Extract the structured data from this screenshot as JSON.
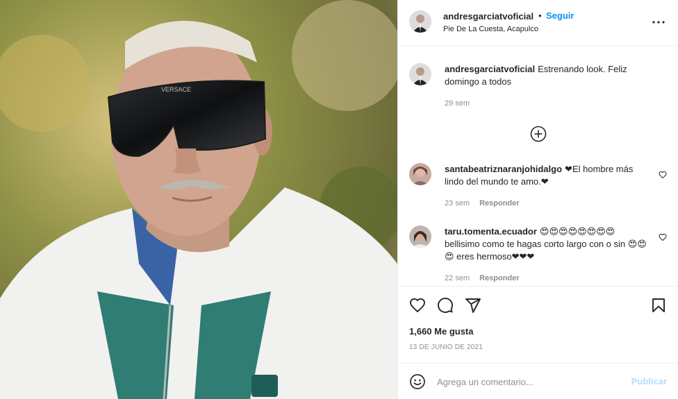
{
  "post": {
    "image_alt": "Man wearing Versace shield sunglasses and white track jacket",
    "sunglasses_brand_text": "VERSACE",
    "author": "andresgarciatvoficial",
    "follow_label": "Seguir",
    "separator": "•",
    "location": "Pie De La Cuesta, Acapulco"
  },
  "caption": {
    "username": "andresgarciatvoficial",
    "text": "Estrenando look. Feliz domingo a todos",
    "time": "29 sem"
  },
  "comments": [
    {
      "username": "santabeatriznaranjohidalgo",
      "text": "❤El hombre más lindo del mundo te amo.❤",
      "time": "23 sem",
      "reply_label": "Responder"
    },
    {
      "username": "taru.tomenta.ecuador",
      "text": "😍😍😍😍😍😍😍😍 bellisimo como te hagas corto largo con o sin 😍😍😍 eres hermoso❤❤❤",
      "time": "22 sem",
      "reply_label": "Responder"
    }
  ],
  "actions": {
    "likes": "1,660 Me gusta",
    "date": "13 DE JUNIO DE 2021"
  },
  "add_comment": {
    "placeholder": "Agrega un comentario...",
    "publish_label": "Publicar"
  },
  "colors": {
    "link_blue": "#0095f6",
    "publish_disabled": "#b2dffc",
    "muted_text": "#8e8e8e",
    "border": "#efefef"
  }
}
